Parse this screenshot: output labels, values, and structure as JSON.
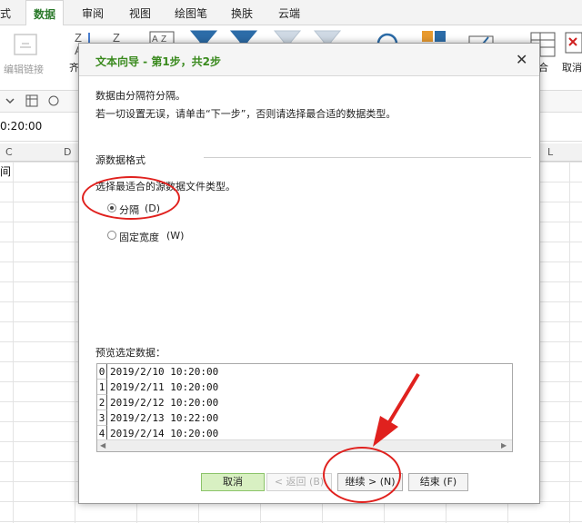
{
  "ribbon_tabs": [
    "式",
    "数据",
    "审阅",
    "视图",
    "绘图笔",
    "换肤",
    "云端"
  ],
  "ribbon": {
    "edit_links_label": "编辑链接",
    "partial_label_left": "齐",
    "partial_label_right_1": "合",
    "partial_label_right_2": "取消"
  },
  "formula_value": "0:20:00",
  "columns": [
    "C",
    "D",
    "L"
  ],
  "cell_a1": "间",
  "dialog": {
    "title": "文本向导 - 第1步，共2步",
    "close_icon": "close-icon",
    "line1": "数据由分隔符分隔。",
    "line2": "若一切设置无误，请单击“下一步”，否则请选择最合适的数据类型。",
    "section_title": "源数据格式",
    "section_desc": "选择最适合的源数据文件类型。",
    "radio_delimited": "分隔",
    "radio_delimited_key": "(D)",
    "radio_fixed": "固定宽度",
    "radio_fixed_key": "(W)",
    "preview_label": "预览选定数据：",
    "preview_rows": [
      {
        "idx": "0",
        "value": "2019/2/10 10:20:00"
      },
      {
        "idx": "1",
        "value": "2019/2/11 10:20:00"
      },
      {
        "idx": "2",
        "value": "2019/2/12 10:20:00"
      },
      {
        "idx": "3",
        "value": "2019/2/13 10:22:00"
      },
      {
        "idx": "4",
        "value": "2019/2/14 10:20:00"
      }
    ],
    "buttons": {
      "cancel": "取消",
      "back": "< 返回 (B)",
      "next": "继续 > (N)",
      "finish": "结束 (F)"
    }
  },
  "colors": {
    "accent_green": "#3a8a1e",
    "annotation_red": "#e0211e"
  }
}
